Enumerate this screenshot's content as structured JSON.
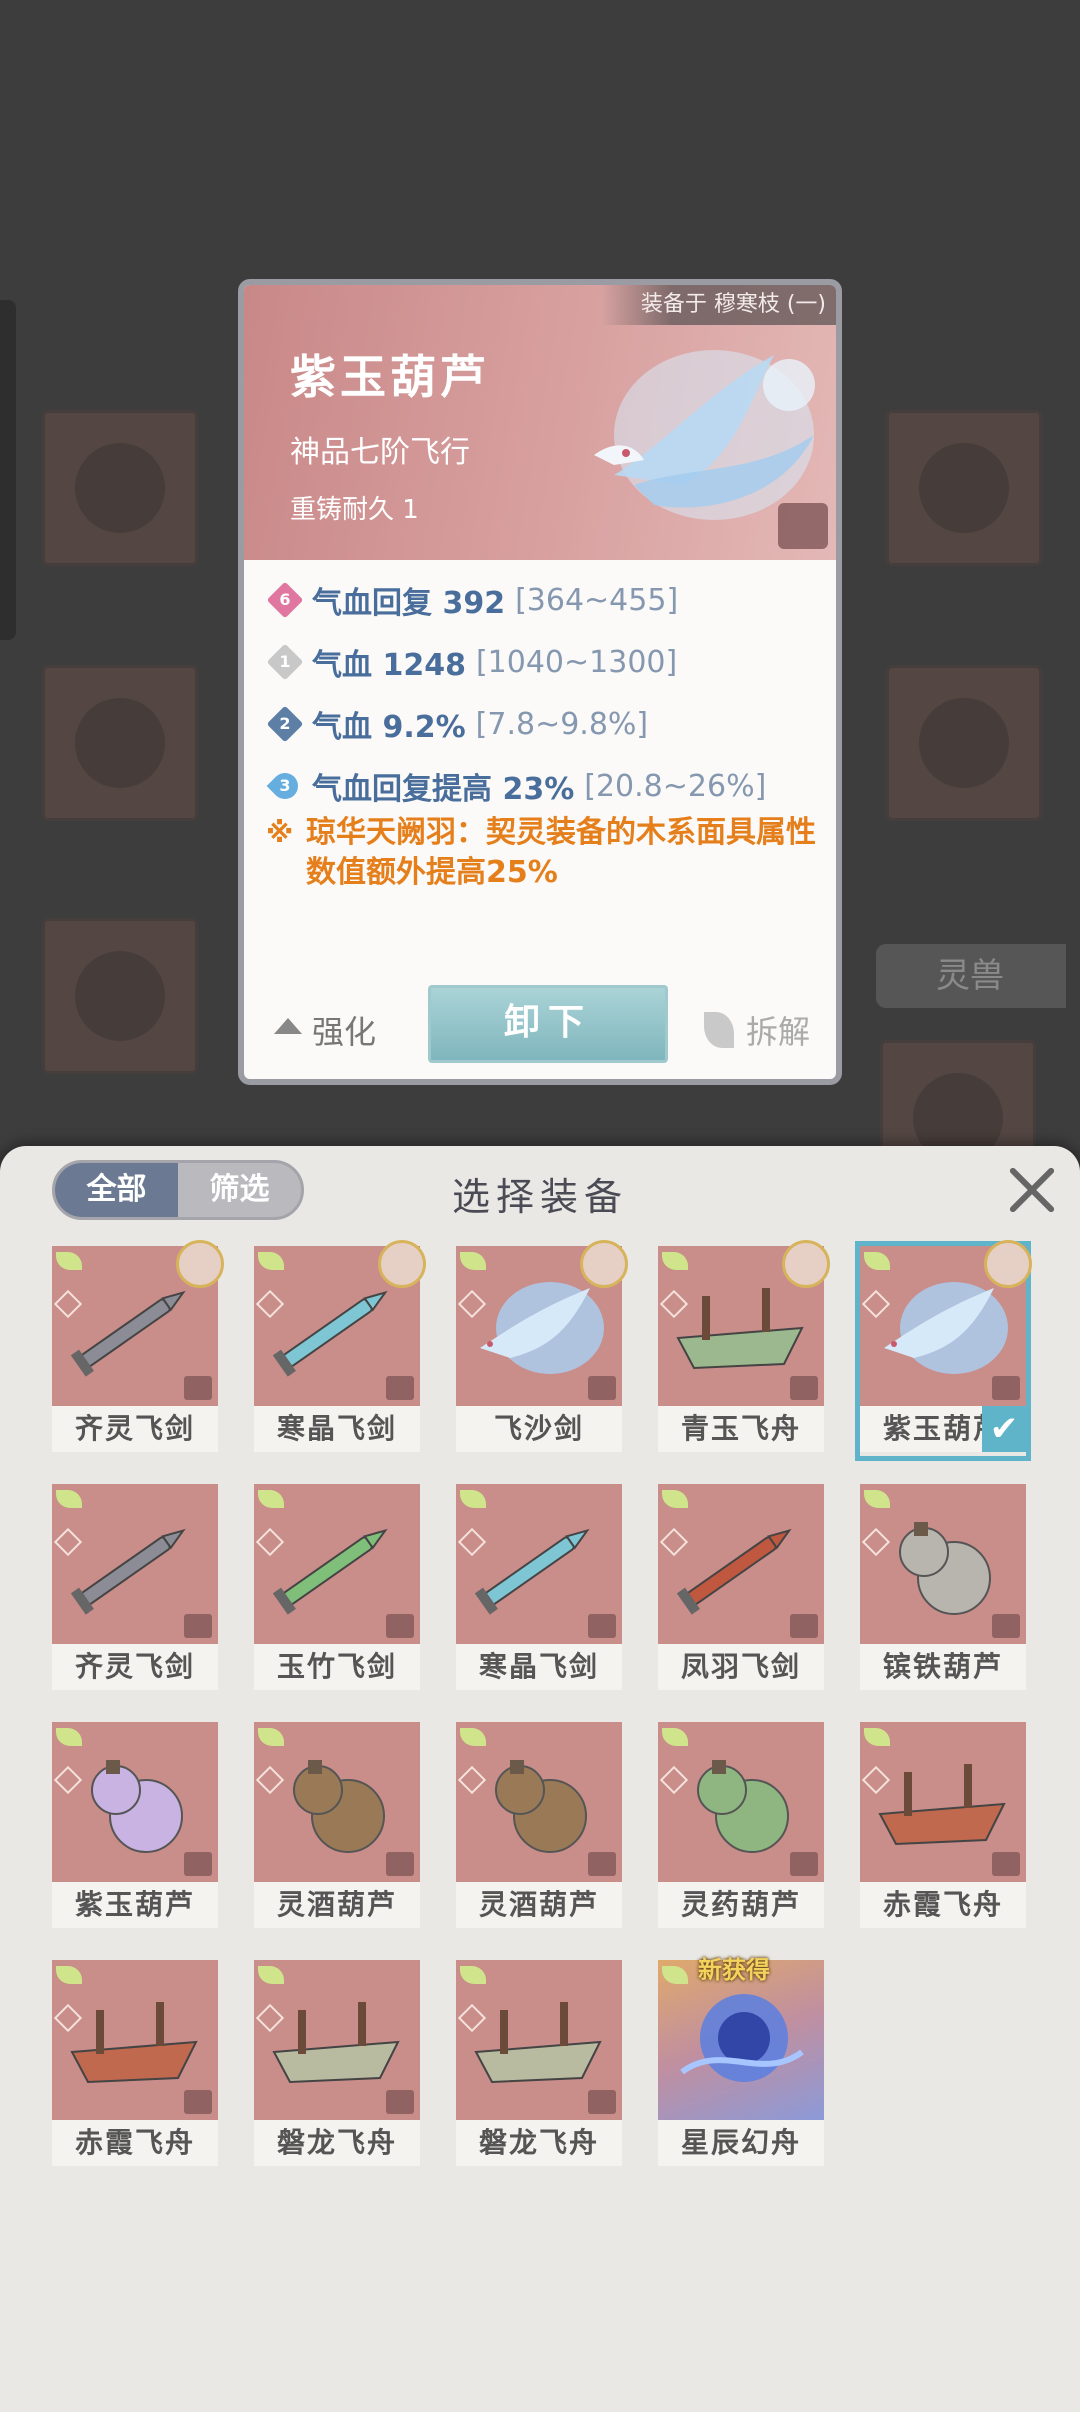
{
  "background": {
    "beast_tab_label": "灵兽"
  },
  "detail": {
    "equipped_text": "装备于 穆寒枝 (一)",
    "name": "紫玉葫芦",
    "grade": "神品七阶飞行",
    "reforge": "重铸耐久 1",
    "stats": [
      {
        "level": "6",
        "text": "气血回复 392",
        "range": "[364~455]",
        "color": "#e077a1"
      },
      {
        "level": "1",
        "text": "气血 1248",
        "range": "[1040~1300]",
        "color": "#c8c8c8"
      },
      {
        "level": "2",
        "text": "气血 9.2%",
        "range": "[7.8~9.8%]",
        "color": "#5d7fa6"
      },
      {
        "level": "3",
        "text": "气血回复提高 23%",
        "range": "[20.8~26%]",
        "color": "#66aee0"
      }
    ],
    "special_mark": "※",
    "special_text": "琼华天阙羽：契灵装备的木系面具属性数值额外提高25%",
    "enhance_label": "强化",
    "unload_label": "卸下",
    "dismantle_label": "拆解"
  },
  "sheet": {
    "title": "选择装备",
    "tabs": [
      {
        "label": "全部",
        "active": true
      },
      {
        "label": "筛选",
        "active": false
      }
    ],
    "new_tag": "新获得",
    "check_mark": "✔",
    "items": [
      {
        "name": "齐灵飞剑",
        "kind": "sword",
        "color": "#8c8c96",
        "avatar": true
      },
      {
        "name": "寒晶飞剑",
        "kind": "sword",
        "color": "#7fc6d4",
        "avatar": true
      },
      {
        "name": "飞沙剑",
        "kind": "phoenix",
        "color": "#a9d0f2",
        "avatar": true
      },
      {
        "name": "青玉飞舟",
        "kind": "boat",
        "color": "#9cb88e",
        "avatar": true
      },
      {
        "name": "紫玉葫芦",
        "kind": "phoenix",
        "color": "#a9d0f2",
        "avatar": true,
        "selected": true
      },
      {
        "name": "齐灵飞剑",
        "kind": "sword",
        "color": "#8c8c96"
      },
      {
        "name": "玉竹飞剑",
        "kind": "sword",
        "color": "#7fbf7a"
      },
      {
        "name": "寒晶飞剑",
        "kind": "sword",
        "color": "#7fc6d4"
      },
      {
        "name": "凤羽飞剑",
        "kind": "sword",
        "color": "#c0573f"
      },
      {
        "name": "镔铁葫芦",
        "kind": "gourd",
        "color": "#b8b4ae"
      },
      {
        "name": "紫玉葫芦",
        "kind": "gourd",
        "color": "#c8b3e3"
      },
      {
        "name": "灵酒葫芦",
        "kind": "gourd",
        "color": "#9a7a56"
      },
      {
        "name": "灵酒葫芦",
        "kind": "gourd",
        "color": "#9a7a56"
      },
      {
        "name": "灵药葫芦",
        "kind": "gourd",
        "color": "#8fb681"
      },
      {
        "name": "赤霞飞舟",
        "kind": "boat",
        "color": "#c0694f"
      },
      {
        "name": "赤霞飞舟",
        "kind": "boat",
        "color": "#c0694f"
      },
      {
        "name": "磐龙飞舟",
        "kind": "boat",
        "color": "#b8bba0"
      },
      {
        "name": "磐龙飞舟",
        "kind": "boat",
        "color": "#b8bba0"
      },
      {
        "name": "星辰幻舟",
        "kind": "orb",
        "color": "#5b7fe0",
        "is_new": true,
        "special_bg": true
      }
    ]
  }
}
